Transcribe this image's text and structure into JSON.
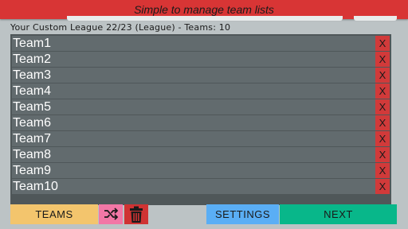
{
  "header": {
    "title": "Simple to manage team lists"
  },
  "league": {
    "summary": "Your Custom League 22/23 (League) - Teams: 10"
  },
  "teams": [
    {
      "name": "Team1",
      "remove_label": "X"
    },
    {
      "name": "Team2",
      "remove_label": "X"
    },
    {
      "name": "Team3",
      "remove_label": "X"
    },
    {
      "name": "Team4",
      "remove_label": "X"
    },
    {
      "name": "Team5",
      "remove_label": "X"
    },
    {
      "name": "Team6",
      "remove_label": "X"
    },
    {
      "name": "Team7",
      "remove_label": "X"
    },
    {
      "name": "Team8",
      "remove_label": "X"
    },
    {
      "name": "Team9",
      "remove_label": "X"
    },
    {
      "name": "Team10",
      "remove_label": "X"
    }
  ],
  "toolbar": {
    "teams_label": "TEAMS",
    "shuffle_icon": "shuffle-icon",
    "delete_icon": "trash-icon",
    "settings_label": "SETTINGS",
    "next_label": "NEXT"
  },
  "colors": {
    "header": "#d83535",
    "teams_button": "#f3c56d",
    "shuffle_button": "#f277a6",
    "delete_button": "#cf3333",
    "settings_button": "#5aaef5",
    "next_button": "#08b78a",
    "remove_button": "#d13a3a",
    "row": "#626b6e"
  }
}
